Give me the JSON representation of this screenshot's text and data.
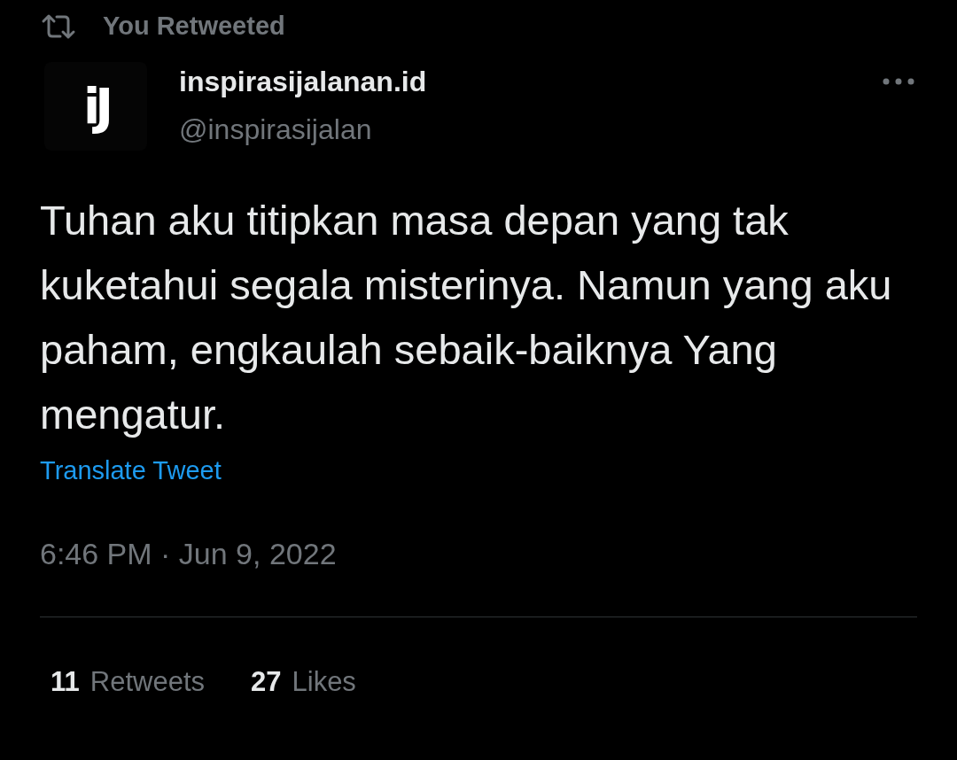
{
  "retweet_banner": {
    "label": "You Retweeted"
  },
  "author": {
    "avatar_text": "iJ",
    "name": "inspirasijalanan.id",
    "handle": "@inspirasijalan"
  },
  "tweet": {
    "text": "Tuhan aku titipkan masa depan yang tak kuketahui segala misterinya. Namun yang aku paham, engkaulah sebaik-baiknya Yang mengatur.",
    "translate_link": "Translate Tweet",
    "timestamp": "6:46 PM · Jun 9, 2022"
  },
  "stats": [
    {
      "count": "11",
      "label": "Retweets"
    },
    {
      "count": "27",
      "label": "Likes"
    }
  ]
}
